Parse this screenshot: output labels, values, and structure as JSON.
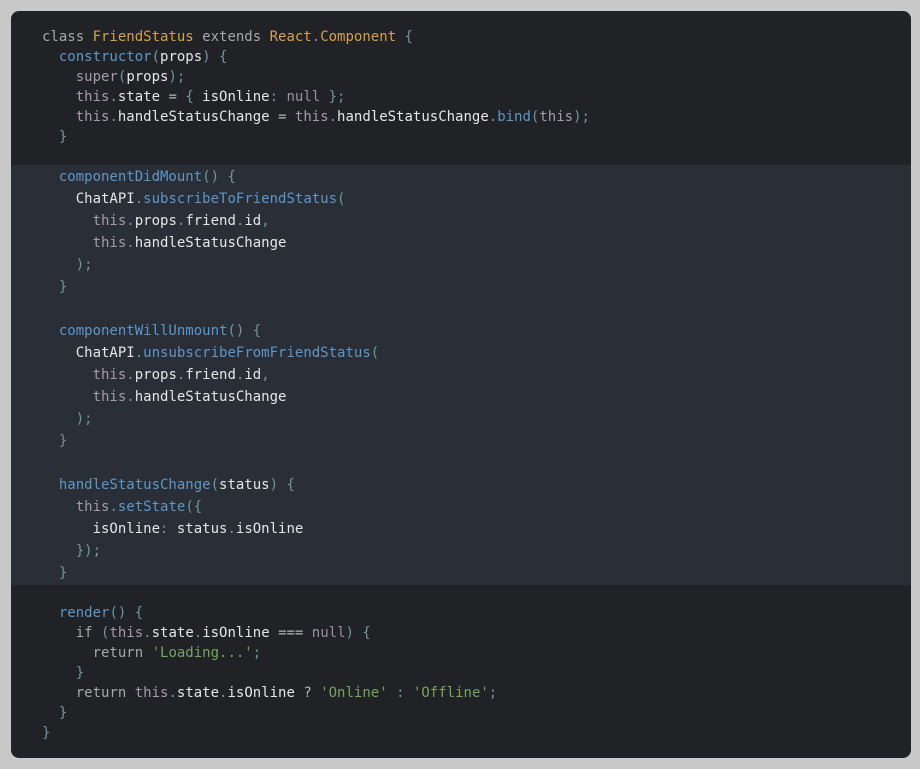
{
  "editor": {
    "language": "javascript",
    "lines": [
      {
        "tokens": [
          {
            "t": "class ",
            "c": "kw"
          },
          {
            "t": "FriendStatus",
            "c": "cls"
          },
          {
            "t": " extends ",
            "c": "kw"
          },
          {
            "t": "React",
            "c": "cls"
          },
          {
            "t": ".",
            "c": "pn"
          },
          {
            "t": "Component",
            "c": "cls"
          },
          {
            "t": " {",
            "c": "pn"
          }
        ]
      },
      {
        "tokens": [
          {
            "t": "  ",
            "c": "id"
          },
          {
            "t": "constructor",
            "c": "fn"
          },
          {
            "t": "(",
            "c": "pn"
          },
          {
            "t": "props",
            "c": "id"
          },
          {
            "t": ") {",
            "c": "pn"
          }
        ]
      },
      {
        "tokens": [
          {
            "t": "    ",
            "c": "id"
          },
          {
            "t": "super",
            "c": "th"
          },
          {
            "t": "(",
            "c": "pn"
          },
          {
            "t": "props",
            "c": "id"
          },
          {
            "t": ");",
            "c": "pn"
          }
        ]
      },
      {
        "tokens": [
          {
            "t": "    ",
            "c": "id"
          },
          {
            "t": "this",
            "c": "th"
          },
          {
            "t": ".",
            "c": "pn"
          },
          {
            "t": "state ",
            "c": "id"
          },
          {
            "t": "= ",
            "c": "op"
          },
          {
            "t": "{ ",
            "c": "pn"
          },
          {
            "t": "isOnline",
            "c": "id"
          },
          {
            "t": ": ",
            "c": "pn"
          },
          {
            "t": "null",
            "c": "nl"
          },
          {
            "t": " };",
            "c": "pn"
          }
        ]
      },
      {
        "tokens": [
          {
            "t": "    ",
            "c": "id"
          },
          {
            "t": "this",
            "c": "th"
          },
          {
            "t": ".",
            "c": "pn"
          },
          {
            "t": "handleStatusChange ",
            "c": "id"
          },
          {
            "t": "= ",
            "c": "op"
          },
          {
            "t": "this",
            "c": "th"
          },
          {
            "t": ".",
            "c": "pn"
          },
          {
            "t": "handleStatusChange",
            "c": "id"
          },
          {
            "t": ".",
            "c": "pn"
          },
          {
            "t": "bind",
            "c": "fn"
          },
          {
            "t": "(",
            "c": "pn"
          },
          {
            "t": "this",
            "c": "th"
          },
          {
            "t": ");",
            "c": "pn"
          }
        ]
      },
      {
        "tokens": [
          {
            "t": "  }",
            "c": "pn"
          }
        ]
      },
      {
        "tokens": [
          {
            "t": "  ",
            "c": "id"
          },
          {
            "t": "componentDidMount",
            "c": "fn"
          },
          {
            "t": "() {",
            "c": "pn"
          }
        ]
      },
      {
        "tokens": [
          {
            "t": "    ",
            "c": "id"
          },
          {
            "t": "ChatAPI",
            "c": "id"
          },
          {
            "t": ".",
            "c": "pn"
          },
          {
            "t": "subscribeToFriendStatus",
            "c": "fn"
          },
          {
            "t": "(",
            "c": "pn"
          }
        ]
      },
      {
        "tokens": [
          {
            "t": "      ",
            "c": "id"
          },
          {
            "t": "this",
            "c": "th"
          },
          {
            "t": ".",
            "c": "pn"
          },
          {
            "t": "props",
            "c": "id"
          },
          {
            "t": ".",
            "c": "pn"
          },
          {
            "t": "friend",
            "c": "id"
          },
          {
            "t": ".",
            "c": "pn"
          },
          {
            "t": "id",
            "c": "id"
          },
          {
            "t": ",",
            "c": "pn"
          }
        ]
      },
      {
        "tokens": [
          {
            "t": "      ",
            "c": "id"
          },
          {
            "t": "this",
            "c": "th"
          },
          {
            "t": ".",
            "c": "pn"
          },
          {
            "t": "handleStatusChange",
            "c": "id"
          }
        ]
      },
      {
        "tokens": [
          {
            "t": "    );",
            "c": "pn"
          }
        ]
      },
      {
        "tokens": [
          {
            "t": "  }",
            "c": "pn"
          }
        ]
      },
      {
        "tokens": [
          {
            "t": "  ",
            "c": "id"
          },
          {
            "t": "componentWillUnmount",
            "c": "fn"
          },
          {
            "t": "() {",
            "c": "pn"
          }
        ]
      },
      {
        "tokens": [
          {
            "t": "    ",
            "c": "id"
          },
          {
            "t": "ChatAPI",
            "c": "id"
          },
          {
            "t": ".",
            "c": "pn"
          },
          {
            "t": "unsubscribeFromFriendStatus",
            "c": "fn"
          },
          {
            "t": "(",
            "c": "pn"
          }
        ]
      },
      {
        "tokens": [
          {
            "t": "      ",
            "c": "id"
          },
          {
            "t": "this",
            "c": "th"
          },
          {
            "t": ".",
            "c": "pn"
          },
          {
            "t": "props",
            "c": "id"
          },
          {
            "t": ".",
            "c": "pn"
          },
          {
            "t": "friend",
            "c": "id"
          },
          {
            "t": ".",
            "c": "pn"
          },
          {
            "t": "id",
            "c": "id"
          },
          {
            "t": ",",
            "c": "pn"
          }
        ]
      },
      {
        "tokens": [
          {
            "t": "      ",
            "c": "id"
          },
          {
            "t": "this",
            "c": "th"
          },
          {
            "t": ".",
            "c": "pn"
          },
          {
            "t": "handleStatusChange",
            "c": "id"
          }
        ]
      },
      {
        "tokens": [
          {
            "t": "    );",
            "c": "pn"
          }
        ]
      },
      {
        "tokens": [
          {
            "t": "  }",
            "c": "pn"
          }
        ]
      },
      {
        "tokens": [
          {
            "t": "  ",
            "c": "id"
          },
          {
            "t": "handleStatusChange",
            "c": "fn"
          },
          {
            "t": "(",
            "c": "pn"
          },
          {
            "t": "status",
            "c": "id"
          },
          {
            "t": ") {",
            "c": "pn"
          }
        ]
      },
      {
        "tokens": [
          {
            "t": "    ",
            "c": "id"
          },
          {
            "t": "this",
            "c": "th"
          },
          {
            "t": ".",
            "c": "pn"
          },
          {
            "t": "setState",
            "c": "fn"
          },
          {
            "t": "({",
            "c": "pn"
          }
        ]
      },
      {
        "tokens": [
          {
            "t": "      ",
            "c": "id"
          },
          {
            "t": "isOnline",
            "c": "id"
          },
          {
            "t": ": ",
            "c": "pn"
          },
          {
            "t": "status",
            "c": "id"
          },
          {
            "t": ".",
            "c": "pn"
          },
          {
            "t": "isOnline",
            "c": "id"
          }
        ]
      },
      {
        "tokens": [
          {
            "t": "    });",
            "c": "pn"
          }
        ]
      },
      {
        "tokens": [
          {
            "t": "  }",
            "c": "pn"
          }
        ]
      },
      {
        "tokens": [
          {
            "t": "  ",
            "c": "id"
          },
          {
            "t": "render",
            "c": "fn"
          },
          {
            "t": "() {",
            "c": "pn"
          }
        ]
      },
      {
        "tokens": [
          {
            "t": "    ",
            "c": "id"
          },
          {
            "t": "if ",
            "c": "kw"
          },
          {
            "t": "(",
            "c": "pn"
          },
          {
            "t": "this",
            "c": "th"
          },
          {
            "t": ".",
            "c": "pn"
          },
          {
            "t": "state",
            "c": "id"
          },
          {
            "t": ".",
            "c": "pn"
          },
          {
            "t": "isOnline ",
            "c": "id"
          },
          {
            "t": "=== ",
            "c": "op"
          },
          {
            "t": "null",
            "c": "nl"
          },
          {
            "t": ") {",
            "c": "pn"
          }
        ]
      },
      {
        "tokens": [
          {
            "t": "      ",
            "c": "id"
          },
          {
            "t": "return ",
            "c": "kw"
          },
          {
            "t": "'Loading...'",
            "c": "str"
          },
          {
            "t": ";",
            "c": "pn"
          }
        ]
      },
      {
        "tokens": [
          {
            "t": "    }",
            "c": "pn"
          }
        ]
      },
      {
        "tokens": [
          {
            "t": "    ",
            "c": "id"
          },
          {
            "t": "return ",
            "c": "kw"
          },
          {
            "t": "this",
            "c": "th"
          },
          {
            "t": ".",
            "c": "pn"
          },
          {
            "t": "state",
            "c": "id"
          },
          {
            "t": ".",
            "c": "pn"
          },
          {
            "t": "isOnline ",
            "c": "id"
          },
          {
            "t": "? ",
            "c": "op"
          },
          {
            "t": "'Online'",
            "c": "str"
          },
          {
            "t": " : ",
            "c": "pn"
          },
          {
            "t": "'Offline'",
            "c": "str"
          },
          {
            "t": ";",
            "c": "pn"
          }
        ]
      },
      {
        "tokens": [
          {
            "t": "  }",
            "c": "pn"
          }
        ]
      },
      {
        "tokens": [
          {
            "t": "}",
            "c": "pn"
          }
        ]
      }
    ],
    "highlighted_lines": [
      6,
      22
    ],
    "colors": {
      "window_bg": "#202226",
      "highlight_bg": "#2a2e36",
      "keyword": "#a7a7a7",
      "class_name": "#d9a04b",
      "function": "#5d97c9",
      "string": "#78a360",
      "punctuation": "#6f97a0",
      "this": "#a79aa9"
    }
  }
}
